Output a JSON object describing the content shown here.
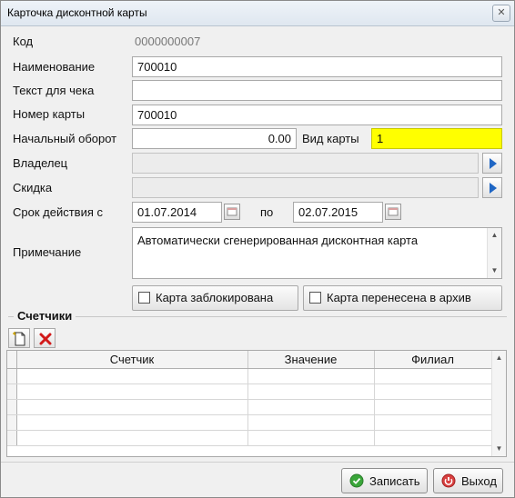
{
  "window": {
    "title": "Карточка дисконтной карты",
    "close_icon": "✕"
  },
  "form": {
    "code_label": "Код",
    "code_value": "0000000007",
    "name_label": "Наименование",
    "name_value": "700010",
    "receipt_label": "Текст для чека",
    "receipt_value": "",
    "card_number_label": "Номер карты",
    "card_number_value": "700010",
    "turnover_label": "Начальный оборот",
    "turnover_value": "0.00",
    "card_type_label": "Вид карты",
    "card_type_value": "1",
    "owner_label": "Владелец",
    "owner_value": "",
    "discount_label": "Скидка",
    "discount_value": "",
    "validity_label": "Срок действия с",
    "validity_from": "01.07.2014",
    "validity_to_label": "по",
    "validity_to": "02.07.2015",
    "note_label": "Примечание",
    "note_value": "Автоматически сгенерированная дисконтная карта",
    "blocked_label": "Карта заблокирована",
    "archived_label": "Карта перенесена в архив",
    "highlight_color": "#ffff00"
  },
  "counters": {
    "group_title": "Счетчики",
    "columns": [
      "Счетчик",
      "Значение",
      "Филиал"
    ],
    "rows": [
      [
        "",
        "",
        ""
      ],
      [
        "",
        "",
        ""
      ],
      [
        "",
        "",
        ""
      ],
      [
        "",
        "",
        ""
      ],
      [
        "",
        "",
        ""
      ]
    ]
  },
  "actions": {
    "save_label": "Записать",
    "exit_label": "Выход"
  }
}
